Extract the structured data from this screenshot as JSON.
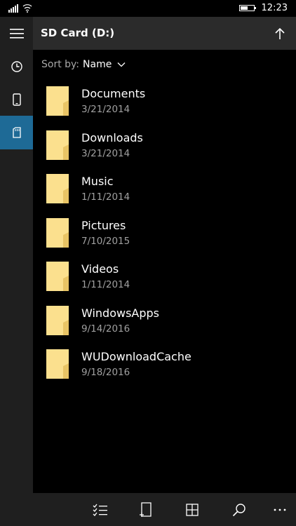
{
  "status_bar": {
    "signal_icon": "signal-bars-icon",
    "wifi_icon": "wifi-icon",
    "battery_icon": "battery-icon",
    "battery_level": 0.6,
    "time": "12:23"
  },
  "sidebar": {
    "items": [
      {
        "icon": "hamburger-menu-icon",
        "active": false
      },
      {
        "icon": "recent-clock-icon",
        "active": false
      },
      {
        "icon": "phone-icon",
        "active": false
      },
      {
        "icon": "sd-card-icon",
        "active": true
      }
    ]
  },
  "header": {
    "title": "SD Card (D:)",
    "up_icon": "up-arrow-icon"
  },
  "sort": {
    "label": "Sort by:",
    "value": "Name",
    "icon": "chevron-down-icon"
  },
  "files": [
    {
      "name": "Documents",
      "date": "3/21/2014",
      "icon": "folder-icon"
    },
    {
      "name": "Downloads",
      "date": "3/21/2014",
      "icon": "folder-icon"
    },
    {
      "name": "Music",
      "date": "1/11/2014",
      "icon": "folder-icon"
    },
    {
      "name": "Pictures",
      "date": "7/10/2015",
      "icon": "folder-icon"
    },
    {
      "name": "Videos",
      "date": "1/11/2014",
      "icon": "folder-icon"
    },
    {
      "name": "WindowsApps",
      "date": "9/14/2016",
      "icon": "folder-icon"
    },
    {
      "name": "WUDownloadCache",
      "date": "9/18/2016",
      "icon": "folder-icon"
    }
  ],
  "bottom_bar": {
    "buttons": [
      {
        "icon": "select-checklist-icon"
      },
      {
        "icon": "new-folder-icon"
      },
      {
        "icon": "grid-view-icon"
      },
      {
        "icon": "search-icon"
      },
      {
        "icon": "more-ellipsis-icon"
      }
    ]
  },
  "colors": {
    "accent": "#1e6a96",
    "background": "#000000",
    "header_bg": "#2b2b2b",
    "sidebar_bg": "#1f1f1f",
    "folder": "#fbe08e",
    "secondary_text": "#a0a0a0"
  }
}
